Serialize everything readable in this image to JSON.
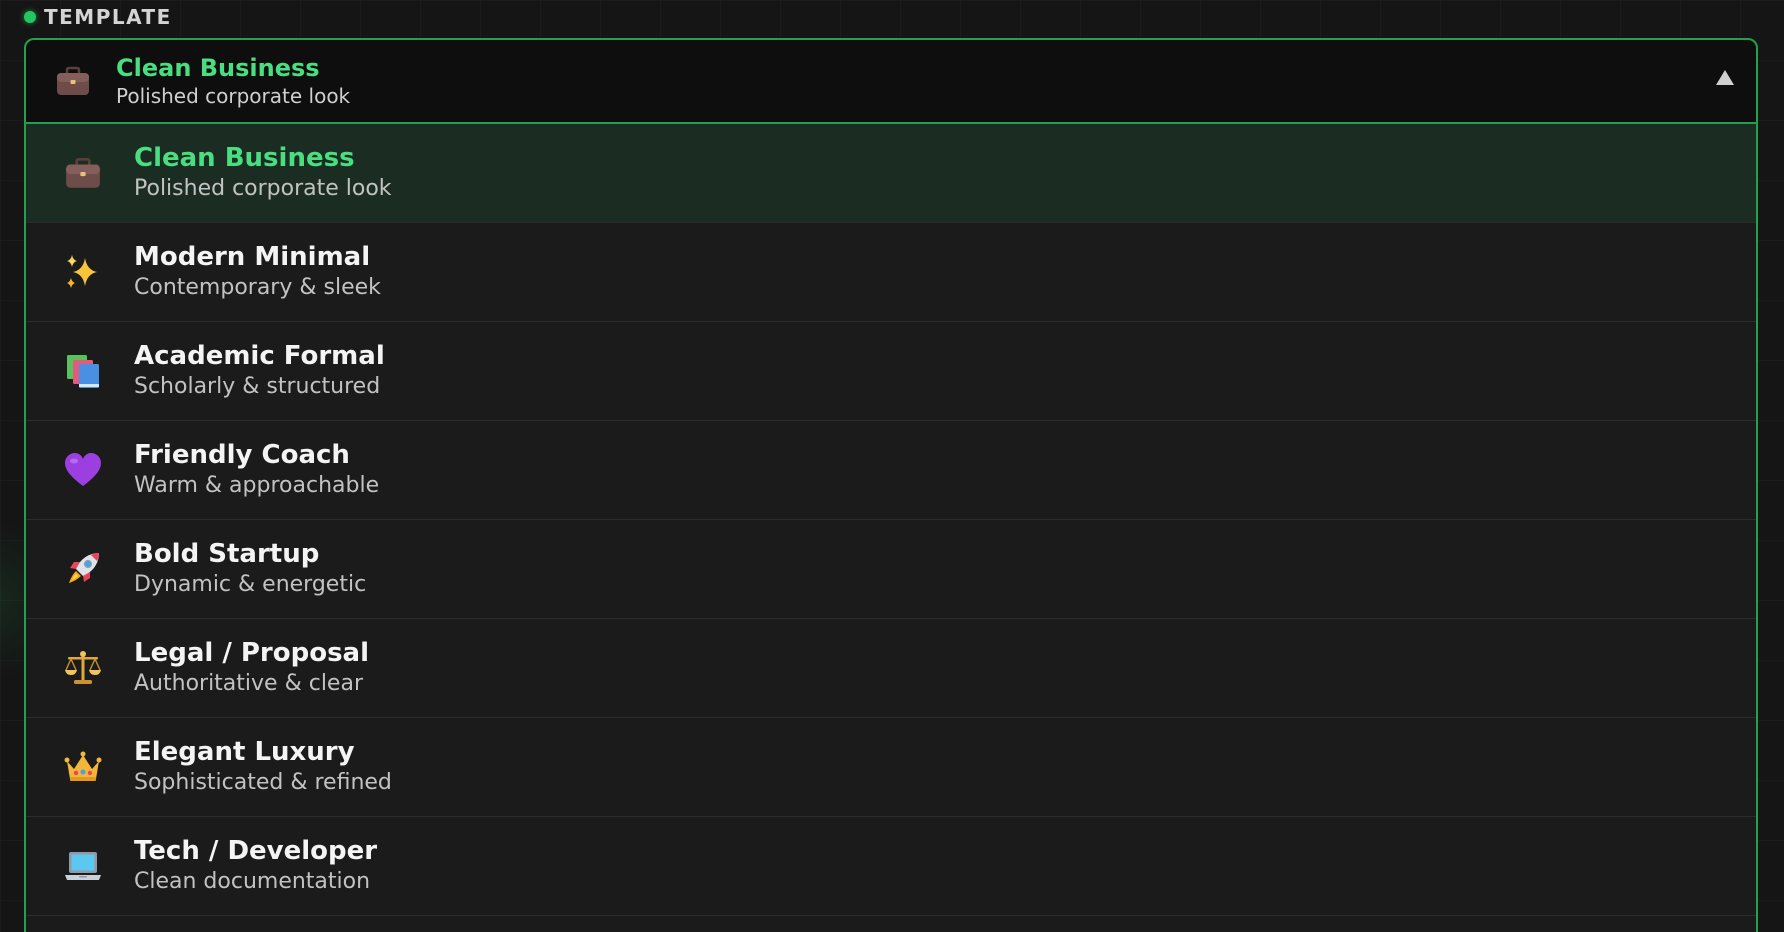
{
  "section": {
    "label": "TEMPLATE",
    "indicator_color": "#22c55e"
  },
  "select": {
    "icon": "briefcase-icon",
    "title": "Clean Business",
    "subtitle": "Polished corporate look",
    "state": "open",
    "caret": "caret-up-icon"
  },
  "options": [
    {
      "icon": "briefcase-icon",
      "title": "Clean Business",
      "subtitle": "Polished corporate look",
      "selected": true
    },
    {
      "icon": "sparkles-icon",
      "title": "Modern Minimal",
      "subtitle": "Contemporary & sleek",
      "selected": false
    },
    {
      "icon": "books-icon",
      "title": "Academic Formal",
      "subtitle": "Scholarly & structured",
      "selected": false
    },
    {
      "icon": "purple-heart-icon",
      "title": "Friendly Coach",
      "subtitle": "Warm & approachable",
      "selected": false
    },
    {
      "icon": "rocket-icon",
      "title": "Bold Startup",
      "subtitle": "Dynamic & energetic",
      "selected": false
    },
    {
      "icon": "balance-scale-icon",
      "title": "Legal / Proposal",
      "subtitle": "Authoritative & clear",
      "selected": false
    },
    {
      "icon": "crown-icon",
      "title": "Elegant Luxury",
      "subtitle": "Sophisticated & refined",
      "selected": false
    },
    {
      "icon": "laptop-icon",
      "title": "Tech / Developer",
      "subtitle": "Clean documentation",
      "selected": false
    }
  ],
  "colors": {
    "accent": "#4ade80",
    "border": "#22a04a",
    "selected_bg": "#1b2d22",
    "list_bg": "#1b1b1b",
    "page_bg": "#151515"
  }
}
